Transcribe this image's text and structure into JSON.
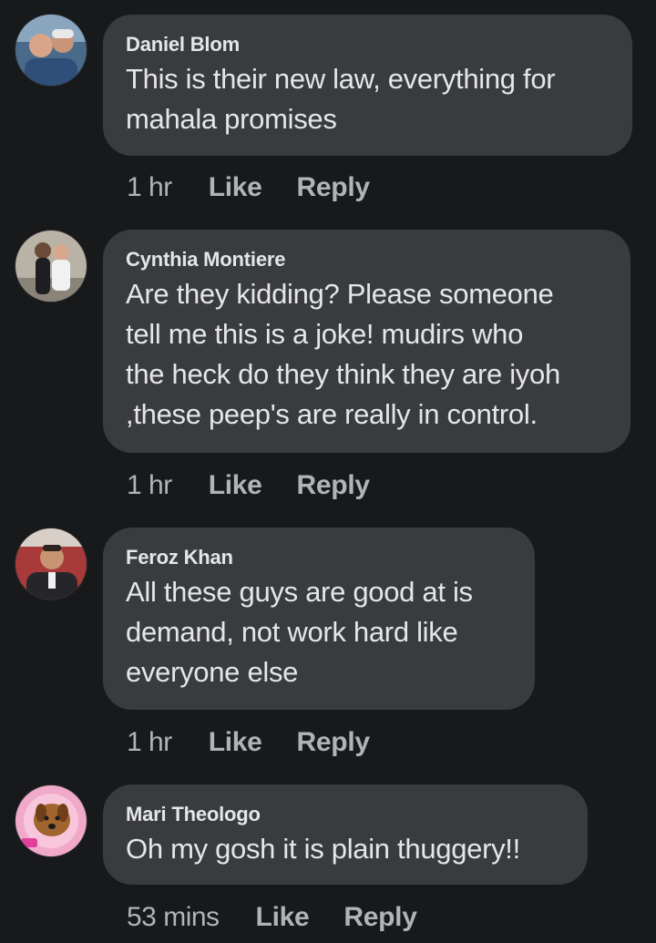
{
  "comments": [
    {
      "author": "Daniel Blom",
      "text": "This is their new law, everything for\nmahala promises",
      "time": "1 hr",
      "like_label": "Like",
      "reply_label": "Reply"
    },
    {
      "author": "Cynthia Montiere",
      "text": "Are they kidding? Please someone\ntell me this is a joke! mudirs who\nthe heck do they think they are iyoh\n,these peep's are really in control.",
      "time": "1 hr",
      "like_label": "Like",
      "reply_label": "Reply"
    },
    {
      "author": "Feroz Khan",
      "text": "All these guys are good at is\ndemand, not work hard like\neveryone else",
      "time": "1 hr",
      "like_label": "Like",
      "reply_label": "Reply"
    },
    {
      "author": "Mari Theologo",
      "text": "Oh my gosh it is plain thuggery!!",
      "time": "53 mins",
      "like_label": "Like",
      "reply_label": "Reply"
    }
  ],
  "colors": {
    "background": "#18191a",
    "bubble": "#3a3b3c",
    "primary_text": "#e4e6eb",
    "secondary_text": "#b0b3b8"
  }
}
